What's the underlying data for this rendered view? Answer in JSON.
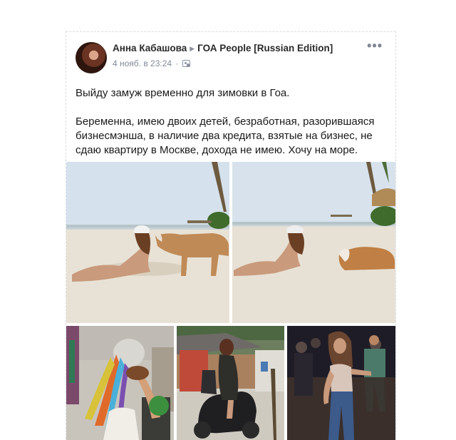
{
  "post": {
    "author": "Анна Кабашова",
    "separator": "▶",
    "group": "ГОА People [Russian Edition]",
    "date": "4 нояб. в 23:24",
    "date_dot": "·",
    "more_label": "•••",
    "paragraph1": "Выйду замуж временно для зимовки в Гоа.",
    "paragraph2": "Беременна, имею двоих детей, безработная, разорившаяся бизнесмэнша, в наличие два кредита, взятые на бизнес, не сдаю квартиру в Москве, дохода не имею. Хочу на море."
  },
  "icons": {
    "privacy": "group-privacy-icon",
    "more": "more-options-icon"
  },
  "photos": [
    {
      "name": "photo-beach-dog-1"
    },
    {
      "name": "photo-beach-dog-2"
    },
    {
      "name": "photo-colorful-hat"
    },
    {
      "name": "photo-scooter"
    },
    {
      "name": "photo-dancing"
    }
  ]
}
